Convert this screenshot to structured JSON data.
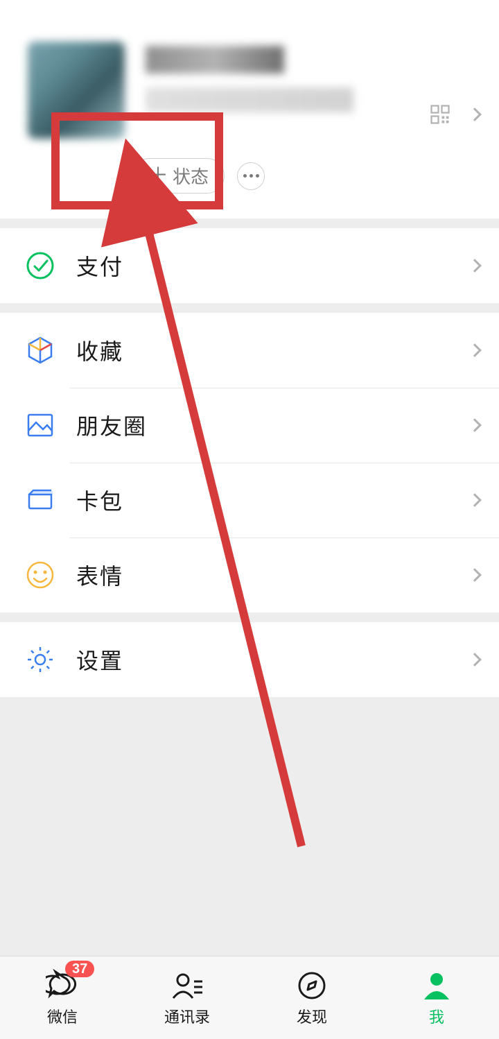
{
  "profile": {
    "status_label": "状态",
    "qr_icon": "qr-icon"
  },
  "menu": {
    "pay": {
      "label": "支付"
    },
    "favorites": {
      "label": "收藏"
    },
    "moments": {
      "label": "朋友圈"
    },
    "cards": {
      "label": "卡包"
    },
    "stickers": {
      "label": "表情"
    },
    "settings": {
      "label": "设置"
    }
  },
  "tabs": {
    "chats": {
      "label": "微信",
      "badge": "37"
    },
    "contacts": {
      "label": "通讯录"
    },
    "discover": {
      "label": "发现"
    },
    "me": {
      "label": "我"
    }
  }
}
